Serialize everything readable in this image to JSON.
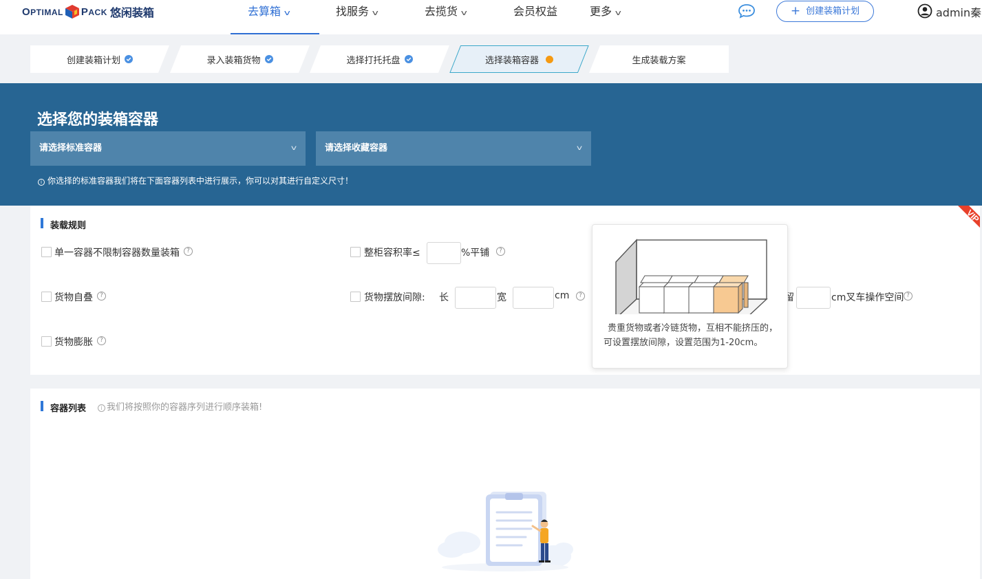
{
  "header": {
    "logo_text": "OPTIMAL PACK",
    "logo_cn": "悠闲装箱",
    "nav": [
      {
        "label": "去算箱",
        "active": true
      },
      {
        "label": "找服务",
        "active": false
      },
      {
        "label": "去揽货",
        "active": false
      },
      {
        "label": "会员权益",
        "active": false
      },
      {
        "label": "更多",
        "active": false
      }
    ],
    "create_button": "创建装箱计划",
    "username": "admin秦"
  },
  "steps": [
    {
      "label": "创建装箱计划",
      "status": "done"
    },
    {
      "label": "录入装箱货物",
      "status": "done"
    },
    {
      "label": "选择打托托盘",
      "status": "done"
    },
    {
      "label": "选择装箱容器",
      "status": "current"
    },
    {
      "label": "生成装载方案",
      "status": "todo"
    }
  ],
  "banner": {
    "title": "选择您的装箱容器",
    "standard_select_placeholder": "请选择标准容器",
    "favorite_select_placeholder": "请选择收藏容器",
    "tip": "你选择的标准容器我们将在下面容器列表中进行展示，你可以对其进行自定义尺寸！"
  },
  "rules": {
    "title": "装载规则",
    "vip_badge": "VIP",
    "single_container": "单一容器不限制容器数量装箱",
    "fill_rate_label": "整柜容积率≤",
    "fill_rate_unit": "%平铺",
    "self_stack": "货物自叠",
    "gap_label": "货物摆放间隙:",
    "gap_length": "长",
    "gap_width": "宽",
    "gap_unit": "cm",
    "reserve_partial": "留",
    "forklift_unit": "cm叉车操作空间",
    "swell": "货物膨胀"
  },
  "tooltip": {
    "text": "贵重货物或者冷链货物，互相不能挤压的，可设置摆放间隙，设置范围为1-20cm。"
  },
  "container_list": {
    "title": "容器列表",
    "tip": "我们将按照你的容器序列进行顺序装箱!"
  },
  "colors": {
    "brand_blue": "#2f6fd4",
    "banner_bg": "#276593",
    "select_bg": "#4f84ab",
    "current_dot": "#f59a12",
    "vip_red": "#e8402a"
  }
}
